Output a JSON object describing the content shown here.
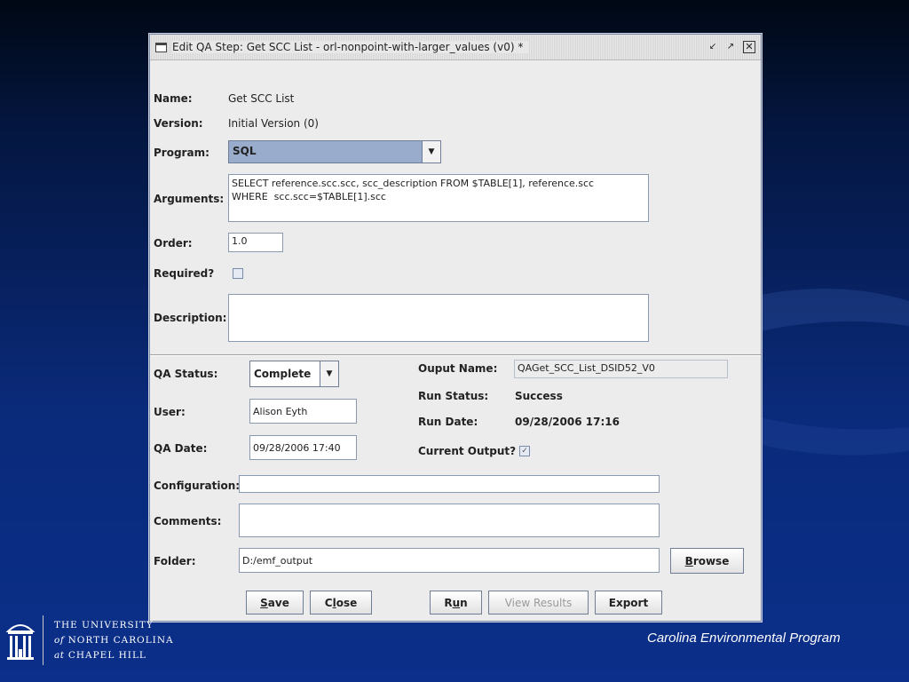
{
  "window": {
    "title": "Edit QA Step: Get SCC List - orl-nonpoint-with-larger_values (v0) *"
  },
  "form": {
    "name_label": "Name:",
    "name_value": "Get SCC List",
    "version_label": "Version:",
    "version_value": "Initial Version (0)",
    "program_label": "Program:",
    "program_value": "SQL",
    "arguments_label": "Arguments:",
    "arguments_value": "SELECT reference.scc.scc, scc_description FROM $TABLE[1], reference.scc\nWHERE  scc.scc=$TABLE[1].scc",
    "order_label": "Order:",
    "order_value": "1.0",
    "required_label": "Required?",
    "required_checked": false,
    "description_label": "Description:",
    "description_value": ""
  },
  "status": {
    "qa_status_label": "QA Status:",
    "qa_status_value": "Complete",
    "user_label": "User:",
    "user_value": "Alison Eyth",
    "qa_date_label": "QA Date:",
    "qa_date_value": "09/28/2006 17:40",
    "output_name_label": "Ouput Name:",
    "output_name_value": "QAGet_SCC_List_DSID52_V0",
    "run_status_label": "Run Status:",
    "run_status_value": "Success",
    "run_date_label": "Run Date:",
    "run_date_value": "09/28/2006 17:16",
    "current_output_label": "Current Output?",
    "current_output_checked": true,
    "configuration_label": "Configuration:",
    "configuration_value": "",
    "comments_label": "Comments:",
    "comments_value": "",
    "folder_label": "Folder:",
    "folder_value": "D:/emf_output"
  },
  "buttons": {
    "browse_u": "B",
    "browse_rest": "rowse",
    "save_u": "S",
    "save_rest": "ave",
    "close_pre": "C",
    "close_u": "l",
    "close_rest": "ose",
    "run_pre": "R",
    "run_u": "u",
    "run_rest": "n",
    "view_results": "View Results",
    "export": "Export"
  },
  "slide": {
    "logo_line1": "THE UNIVERSITY",
    "logo_line2_italic": "of",
    "logo_line2": "NORTH CAROLINA",
    "logo_line3_italic": "at",
    "logo_line3": "CHAPEL HILL",
    "footer": "Carolina Environmental  Program"
  }
}
